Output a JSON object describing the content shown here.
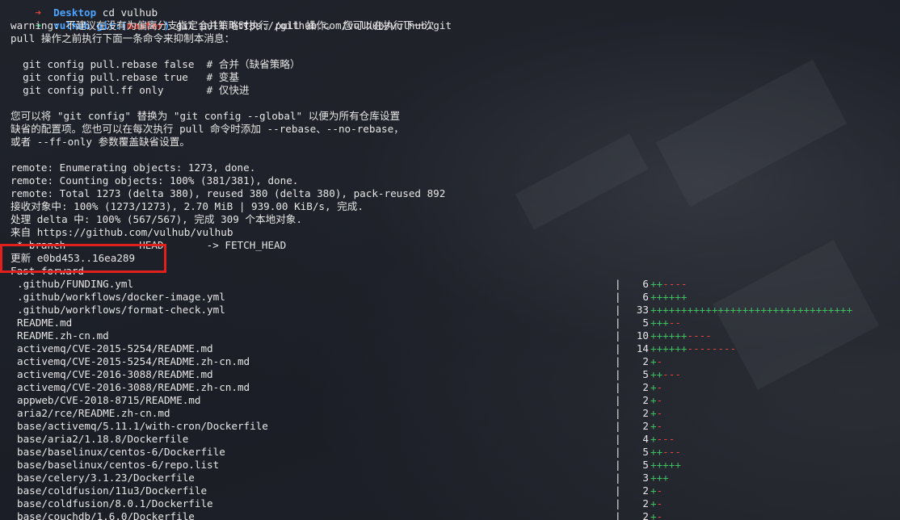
{
  "prompt1": {
    "arrow": "➜",
    "dir": "Desktop",
    "command": "cd vulhub"
  },
  "prompt2": {
    "arrow": "➜",
    "dir": "vulhub",
    "git_label": "git:(",
    "branch": "master",
    "git_close": ")",
    "command": "git pull https://github.com/vulhub/vulhub.git"
  },
  "output_lines": [
    "warning: 不建议在没有为偏离分支指定合并策略时执行 pull 操作。 您可以在执行下一次",
    "pull 操作之前执行下面一条命令来抑制本消息：",
    "",
    "  git config pull.rebase false  # 合并（缺省策略）",
    "  git config pull.rebase true   # 变基",
    "  git config pull.ff only       # 仅快进",
    "",
    "您可以将 \"git config\" 替换为 \"git config --global\" 以便为所有仓库设置",
    "缺省的配置项。您也可以在每次执行 pull 命令时添加 --rebase、--no-rebase，",
    "或者 --ff-only 参数覆盖缺省设置。",
    "",
    "remote: Enumerating objects: 1273, done.",
    "remote: Counting objects: 100% (381/381), done.",
    "remote: Total 1273 (delta 380), reused 380 (delta 380), pack-reused 892",
    "接收对象中: 100% (1273/1273), 2.70 MiB | 939.00 KiB/s, 完成.",
    "处理 delta 中: 100% (567/567), 完成 309 个本地对象.",
    "来自 https://github.com/vulhub/vulhub",
    " * branch            HEAD       -> FETCH_HEAD",
    "更新 e0bd453..16ea289",
    "Fast-forward"
  ],
  "files": [
    {
      "path": ".github/FUNDING.yml",
      "count": "6",
      "plus": "++",
      "minus": "----"
    },
    {
      "path": ".github/workflows/docker-image.yml",
      "count": "6",
      "plus": "++++++",
      "minus": ""
    },
    {
      "path": ".github/workflows/format-check.yml",
      "count": "33",
      "plus": "+++++++++++++++++++++++++++++++++",
      "minus": ""
    },
    {
      "path": "README.md",
      "count": "5",
      "plus": "+++",
      "minus": "--"
    },
    {
      "path": "README.zh-cn.md",
      "count": "10",
      "plus": "++++++",
      "minus": "----"
    },
    {
      "path": "activemq/CVE-2015-5254/README.md",
      "count": "14",
      "plus": "++++++",
      "minus": "--------"
    },
    {
      "path": "activemq/CVE-2015-5254/README.zh-cn.md",
      "count": "2",
      "plus": "+",
      "minus": "-"
    },
    {
      "path": "activemq/CVE-2016-3088/README.md",
      "count": "5",
      "plus": "++",
      "minus": "---"
    },
    {
      "path": "activemq/CVE-2016-3088/README.zh-cn.md",
      "count": "2",
      "plus": "+",
      "minus": "-"
    },
    {
      "path": "appweb/CVE-2018-8715/README.md",
      "count": "2",
      "plus": "+",
      "minus": "-"
    },
    {
      "path": "aria2/rce/README.zh-cn.md",
      "count": "2",
      "plus": "+",
      "minus": "-"
    },
    {
      "path": "base/activemq/5.11.1/with-cron/Dockerfile",
      "count": "2",
      "plus": "+",
      "minus": "-"
    },
    {
      "path": "base/aria2/1.18.8/Dockerfile",
      "count": "4",
      "plus": "+",
      "minus": "---"
    },
    {
      "path": "base/baselinux/centos-6/Dockerfile",
      "count": "5",
      "plus": "++",
      "minus": "---"
    },
    {
      "path": "base/baselinux/centos-6/repo.list",
      "count": "5",
      "plus": "+++++",
      "minus": ""
    },
    {
      "path": "base/celery/3.1.23/Dockerfile",
      "count": "3",
      "plus": "+++",
      "minus": ""
    },
    {
      "path": "base/coldfusion/11u3/Dockerfile",
      "count": "2",
      "plus": "+",
      "minus": "-"
    },
    {
      "path": "base/coldfusion/8.0.1/Dockerfile",
      "count": "2",
      "plus": "+",
      "minus": "-"
    },
    {
      "path": "base/couchdb/1.6.0/Dockerfile",
      "count": "2",
      "plus": "+",
      "minus": "-"
    }
  ],
  "colors": {
    "highlight": "#e0201c",
    "plus": "#3fbf5f",
    "minus": "#e0443e",
    "dir": "#4aa3ff"
  }
}
